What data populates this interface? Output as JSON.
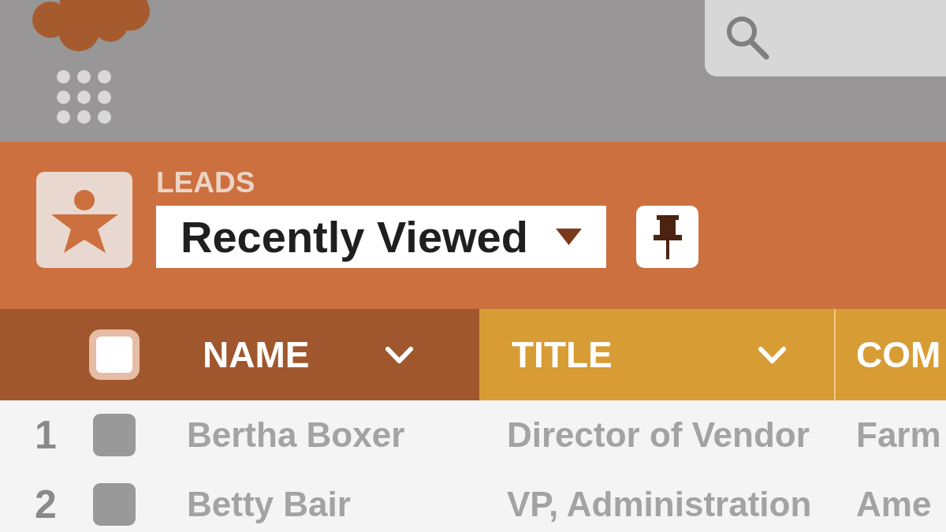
{
  "header": {
    "object_label": "LEADS",
    "list_view": "Recently Viewed"
  },
  "table": {
    "select_all": {
      "checked": false
    },
    "columns": [
      {
        "label": "NAME",
        "selected": true,
        "menu": true
      },
      {
        "label": "TITLE",
        "selected": false,
        "menu": true
      },
      {
        "label": "COM",
        "selected": false,
        "menu": false
      }
    ],
    "rows": [
      {
        "number": "1",
        "checked": false,
        "cells": [
          "Bertha Boxer",
          "Director of Vendor",
          "Farm"
        ]
      },
      {
        "number": "2",
        "checked": false,
        "cells": [
          "Betty Bair",
          "VP, Administration",
          "Ame"
        ]
      }
    ]
  }
}
